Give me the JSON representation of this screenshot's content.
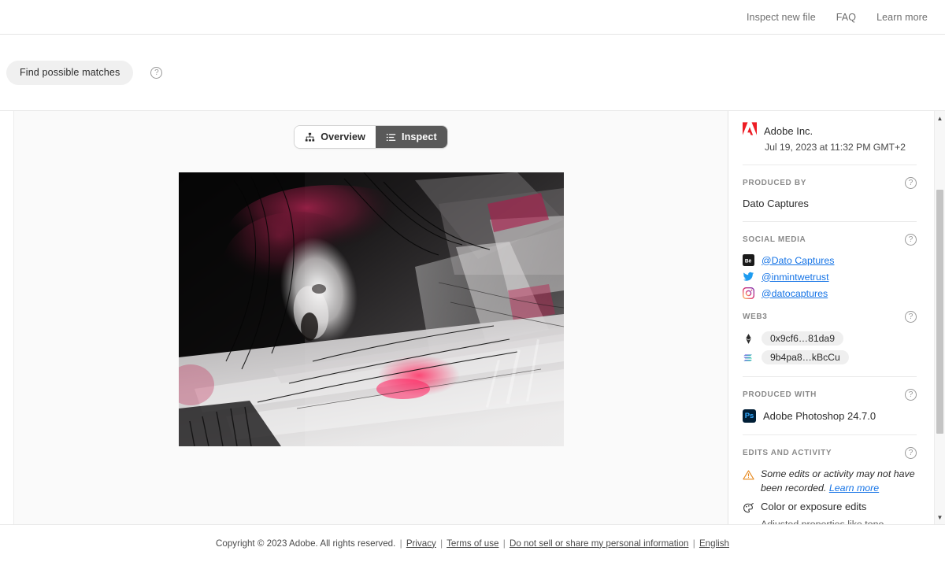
{
  "topnav": {
    "links": [
      {
        "label": "Inspect new file",
        "name": "inspect-new-file-link"
      },
      {
        "label": "FAQ",
        "name": "faq-link"
      },
      {
        "label": "Learn more",
        "name": "learn-more-link"
      }
    ]
  },
  "actionbar": {
    "find_matches_label": "Find possible matches",
    "help_glyph": "?"
  },
  "tabs": [
    {
      "label": "Overview",
      "icon": "hierarchy-icon",
      "active": false
    },
    {
      "label": "Inspect",
      "icon": "list-icon",
      "active": true
    }
  ],
  "artwork": {
    "alt": "Abstract dark painting with crimson and white brushstrokes over a screaming face"
  },
  "sidebar": {
    "owner": {
      "name": "Adobe Inc.",
      "icon": "adobe-logo-icon",
      "date": "Jul 19, 2023 at 11:32 PM GMT+2"
    },
    "produced_by": {
      "label": "Produced by",
      "value": "Dato Captures",
      "help_glyph": "?"
    },
    "social_media": {
      "label": "Social media",
      "help_glyph": "?",
      "accounts": [
        {
          "handle": "@Dato Captures",
          "icon": "behance-icon"
        },
        {
          "handle": "@inmintwetrust",
          "icon": "twitter-icon"
        },
        {
          "handle": "@datocaptures",
          "icon": "instagram-icon"
        }
      ]
    },
    "web3": {
      "label": "Web3",
      "help_glyph": "?",
      "wallets": [
        {
          "address": "0x9cf6…81da9",
          "icon": "ethereum-icon"
        },
        {
          "address": "9b4pa8…kBcCu",
          "icon": "solana-icon"
        }
      ]
    },
    "produced_with": {
      "label": "Produced with",
      "help_glyph": "?",
      "app": "Adobe Photoshop 24.7.0",
      "app_badge": "Ps"
    },
    "edits_and_activity": {
      "label": "Edits and activity",
      "help_glyph": "?",
      "warning": {
        "icon": "warning-triangle-icon",
        "text": "Some edits or activity may not have been recorded.",
        "link": "Learn more"
      },
      "entries": [
        {
          "icon": "color-palette-icon",
          "title": "Color or exposure edits",
          "description": "Adjusted properties like tone, saturation, curves, shadows, or highlights"
        }
      ]
    }
  },
  "footer": {
    "copyright": "Copyright © 2023 Adobe. All rights reserved.",
    "links": [
      {
        "label": "Privacy",
        "name": "privacy-link"
      },
      {
        "label": "Terms of use",
        "name": "terms-of-use-link"
      },
      {
        "label": "Do not sell or share my personal information",
        "name": "do-not-sell-link"
      },
      {
        "label": "English",
        "name": "language-link"
      }
    ],
    "separator": "|"
  },
  "colors": {
    "accent_link": "#1473e6",
    "adobe_red": "#ed1c24",
    "tab_active_bg": "#595959",
    "warning_orange": "#e68619"
  }
}
